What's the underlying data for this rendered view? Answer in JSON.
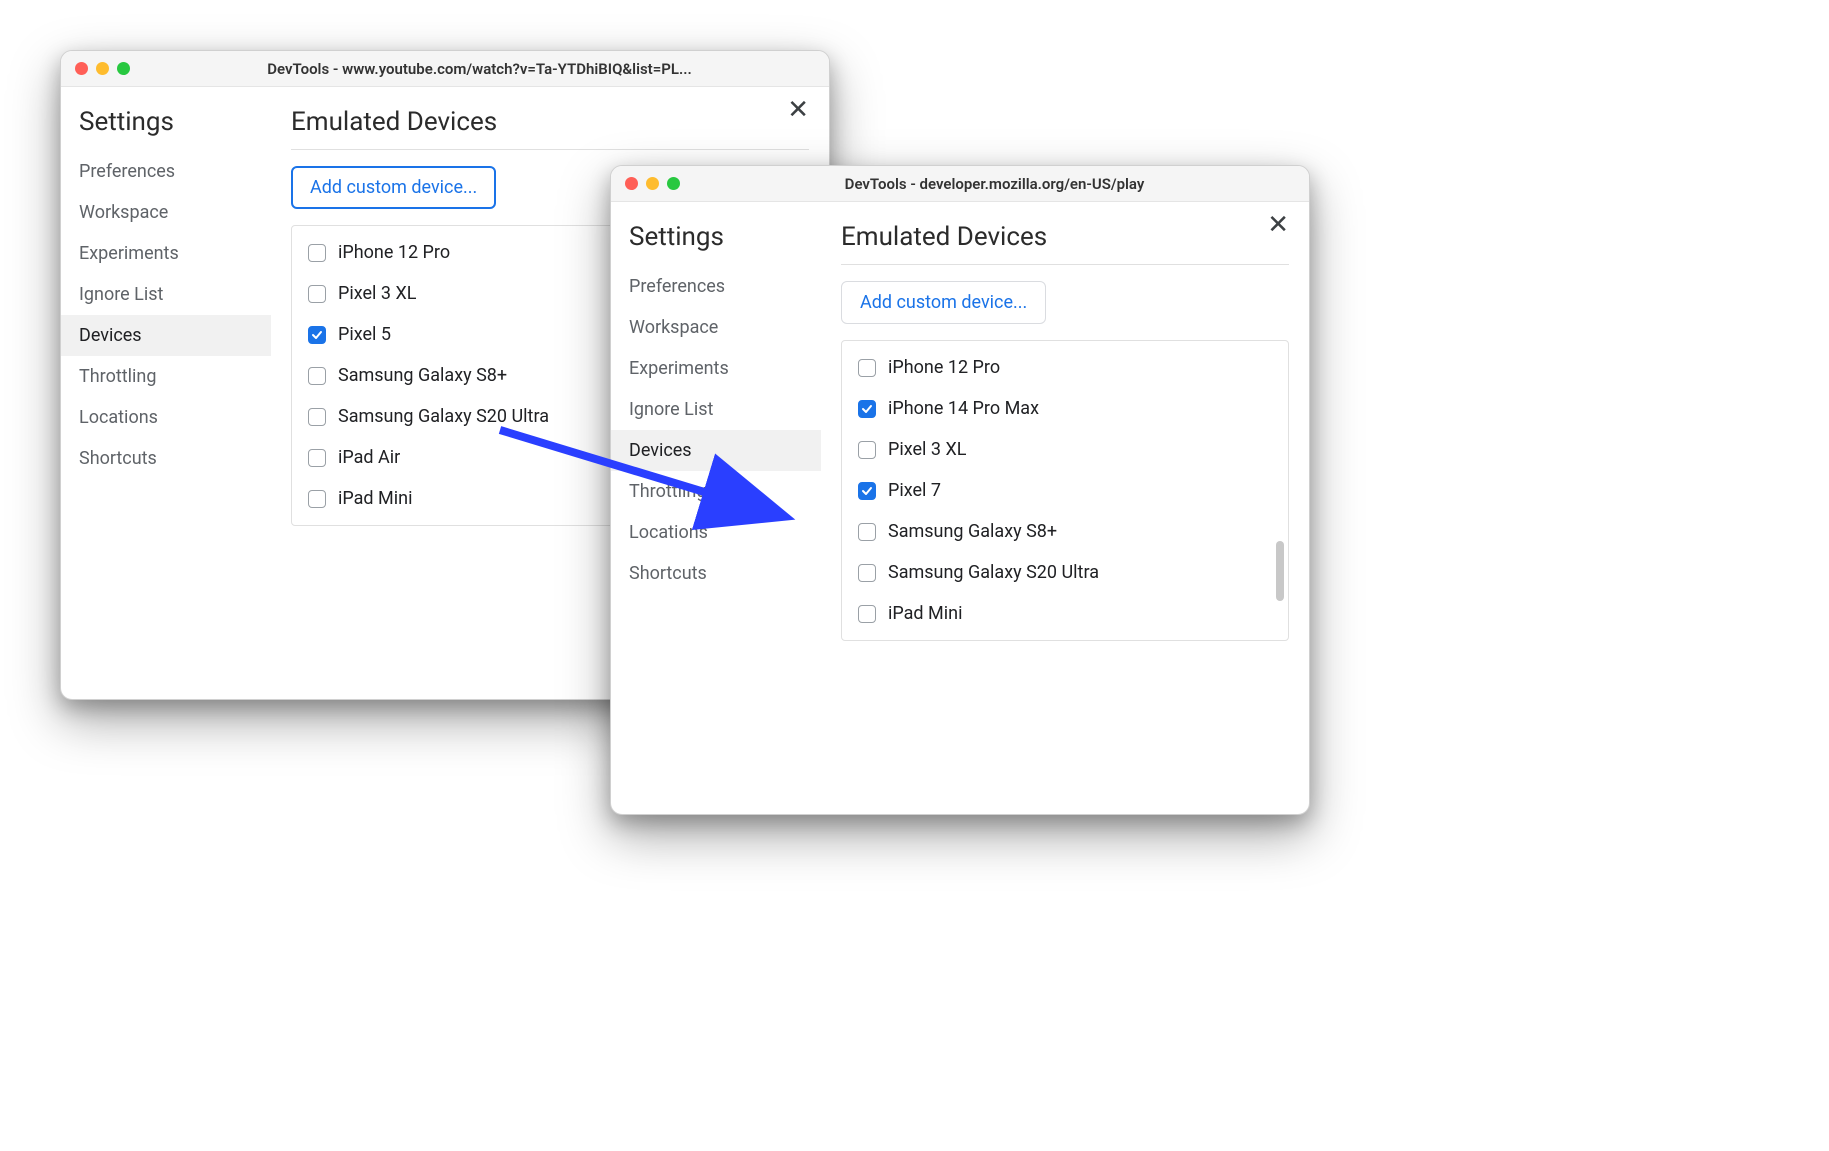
{
  "windows": {
    "back": {
      "title": "DevTools - www.youtube.com/watch?v=Ta-YTDhiBIQ&list=PL...",
      "sidebar_title": "Settings",
      "sidebar_items": [
        "Preferences",
        "Workspace",
        "Experiments",
        "Ignore List",
        "Devices",
        "Throttling",
        "Locations",
        "Shortcuts"
      ],
      "active_index": 4,
      "main_title": "Emulated Devices",
      "add_button": "Add custom device...",
      "add_button_focused": true,
      "devices": [
        {
          "label": "iPhone 12 Pro",
          "checked": false
        },
        {
          "label": "Pixel 3 XL",
          "checked": false
        },
        {
          "label": "Pixel 5",
          "checked": true
        },
        {
          "label": "Samsung Galaxy S8+",
          "checked": false
        },
        {
          "label": "Samsung Galaxy S20 Ultra",
          "checked": false
        },
        {
          "label": "iPad Air",
          "checked": false
        },
        {
          "label": "iPad Mini",
          "checked": false
        }
      ]
    },
    "front": {
      "title": "DevTools - developer.mozilla.org/en-US/play",
      "sidebar_title": "Settings",
      "sidebar_items": [
        "Preferences",
        "Workspace",
        "Experiments",
        "Ignore List",
        "Devices",
        "Throttling",
        "Locations",
        "Shortcuts"
      ],
      "active_index": 4,
      "main_title": "Emulated Devices",
      "add_button": "Add custom device...",
      "add_button_focused": false,
      "devices": [
        {
          "label": "iPhone 12 Pro",
          "checked": false
        },
        {
          "label": "iPhone 14 Pro Max",
          "checked": true
        },
        {
          "label": "Pixel 3 XL",
          "checked": false
        },
        {
          "label": "Pixel 7",
          "checked": true
        },
        {
          "label": "Samsung Galaxy S8+",
          "checked": false
        },
        {
          "label": "Samsung Galaxy S20 Ultra",
          "checked": false
        },
        {
          "label": "iPad Mini",
          "checked": false
        }
      ],
      "show_scrollbar": true
    }
  }
}
